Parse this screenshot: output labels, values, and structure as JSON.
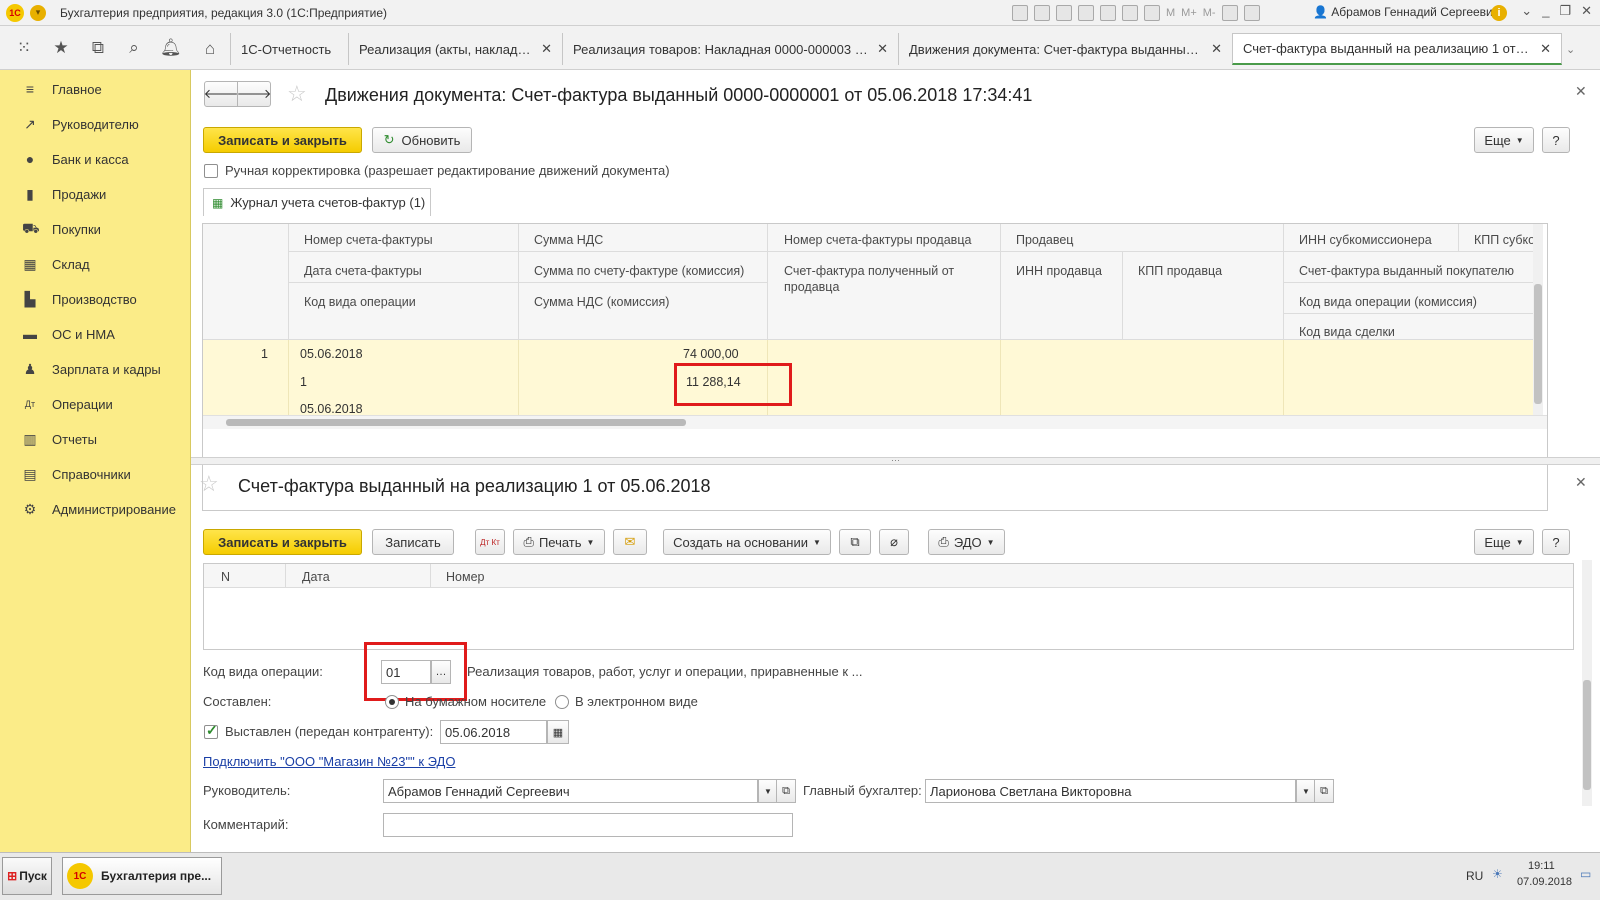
{
  "titlebar": {
    "logo": "1C",
    "title": "Бухгалтерия предприятия, редакция 3.0  (1С:Предприятие)",
    "user": "Абрамов Геннадий Сергеевич",
    "m_labels": [
      "M",
      "M+",
      "M-"
    ]
  },
  "tabs": [
    {
      "label": "1С-Отчетность"
    },
    {
      "label": "Реализация (акты, накладные)"
    },
    {
      "label": "Реализация товаров: Накладная 0000-000003 о..."
    },
    {
      "label": "Движения документа: Счет-фактура выданный ..."
    },
    {
      "label": "Счет-фактура выданный на реализацию 1 от 05..."
    }
  ],
  "sidebar": {
    "items": [
      {
        "label": "Главное",
        "icon": "menu-icon"
      },
      {
        "label": "Руководителю",
        "icon": "trend-icon"
      },
      {
        "label": "Банк и касса",
        "icon": "coin-icon"
      },
      {
        "label": "Продажи",
        "icon": "bag-icon"
      },
      {
        "label": "Покупки",
        "icon": "cart-icon"
      },
      {
        "label": "Склад",
        "icon": "warehouse-icon"
      },
      {
        "label": "Производство",
        "icon": "factory-icon"
      },
      {
        "label": "ОС и НМА",
        "icon": "truck-icon"
      },
      {
        "label": "Зарплата и кадры",
        "icon": "people-icon"
      },
      {
        "label": "Операции",
        "icon": "dt-kt-icon"
      },
      {
        "label": "Отчеты",
        "icon": "chart-icon"
      },
      {
        "label": "Справочники",
        "icon": "book-icon"
      },
      {
        "label": "Администрирование",
        "icon": "gear-icon"
      }
    ]
  },
  "top_form": {
    "title": "Движения документа: Счет-фактура выданный 0000-0000001 от 05.06.2018 17:34:41",
    "save_close": "Записать и закрыть",
    "refresh": "Обновить",
    "more": "Еще",
    "help": "?",
    "manual_checkbox": "Ручная корректировка (разрешает редактирование движений документа)",
    "grid_tab": "Журнал учета счетов-фактур (1)",
    "headers": {
      "num_sf": "Номер счета-фактуры",
      "date_sf": "Дата счета-фактуры",
      "kod_vida": "Код вида операции",
      "summa_nds": "Сумма НДС",
      "summa_sf_kom": "Сумма по счету-фактуре (комиссия)",
      "summa_nds_kom": "Сумма НДС (комиссия)",
      "num_sf_prod": "Номер счета-фактуры продавца",
      "sf_received": "Счет-фактура полученный от продавца",
      "prodavec": "Продавец",
      "inn_prod": "ИНН продавца",
      "kpp_prod": "КПП продавца",
      "inn_sub": "ИНН субкомиссионера",
      "kpp_sub": "КПП субко",
      "sf_issued": "Счет-фактура выданный покупателю",
      "kod_vida_kom": "Код вида операции (комиссия)",
      "kod_vida_sdelki": "Код вида сделки"
    },
    "row": {
      "n": "1",
      "date": "05.06.2018",
      "num": "1",
      "date2": "05.06.2018",
      "summa": "74 000,00",
      "nds": "11 288,14"
    }
  },
  "bottom_form": {
    "title": "Счет-фактура выданный на реализацию 1 от 05.06.2018",
    "save_close": "Записать и закрыть",
    "save": "Записать",
    "dtkt": "Дт Кт",
    "print": "Печать",
    "create_based": "Создать на основании",
    "edo": "ЭДО",
    "more": "Еще",
    "help": "?",
    "table_headers": [
      "N",
      "Дата",
      "Номер"
    ],
    "kod_vida_label": "Код вида операции:",
    "kod_vida_value": "01",
    "kod_vida_desc": "Реализация товаров, работ, услуг и операции, приравненные к ...",
    "sostavlen_label": "Составлен:",
    "paper": "На бумажном носителе",
    "electronic": "В электронном виде",
    "vystavlen_label": "Выставлен (передан контрагенту):",
    "vystavlen_date": "05.06.2018",
    "edo_link": "Подключить \"ООО \"Магазин №23\"\" к ЭДО",
    "rukovoditel_label": "Руководитель:",
    "rukovoditel_value": "Абрамов Геннадий Сергеевич",
    "buh_label": "Главный бухгалтер:",
    "buh_value": "Ларионова Светлана Викторовна",
    "comment_label": "Комментарий:"
  },
  "taskbar": {
    "start": "Пуск",
    "task": "Бухгалтерия пре...",
    "lang": "RU",
    "time": "19:11",
    "date": "07.09.2018"
  },
  "colors": {
    "sidebar": "#fbec88",
    "accent_yellow": "#f5cc00",
    "highlight_red": "#e01b1b",
    "row_highlight": "#fff9d6"
  }
}
